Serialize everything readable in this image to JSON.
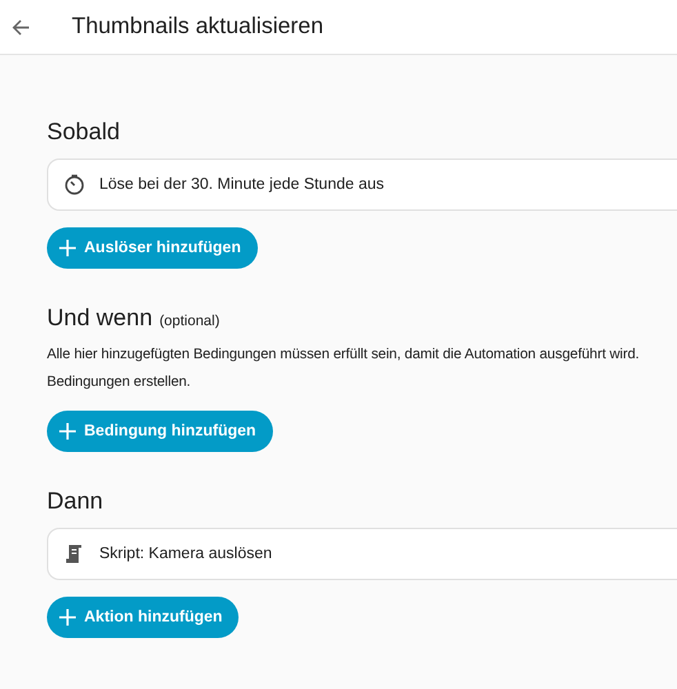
{
  "header": {
    "title": "Thumbnails aktualisieren"
  },
  "sections": [
    {
      "title": "Sobald",
      "items": [
        {
          "kind": "timer",
          "label": "Löse bei der 30. Minute jede Stunde aus"
        }
      ],
      "button": "Auslöser hinzufügen"
    },
    {
      "title": "Und wenn",
      "note": "(optional)",
      "description": [
        "Alle hier hinzugefügten Bedingungen müssen erfüllt sein, damit die Automation ausgeführt wird.",
        "Bedingungen erstellen."
      ],
      "button": "Bedingung hinzufügen"
    },
    {
      "title": "Dann",
      "items": [
        {
          "kind": "script",
          "label": "Skript: Kamera auslösen"
        }
      ],
      "button": "Aktion hinzufügen"
    }
  ]
}
